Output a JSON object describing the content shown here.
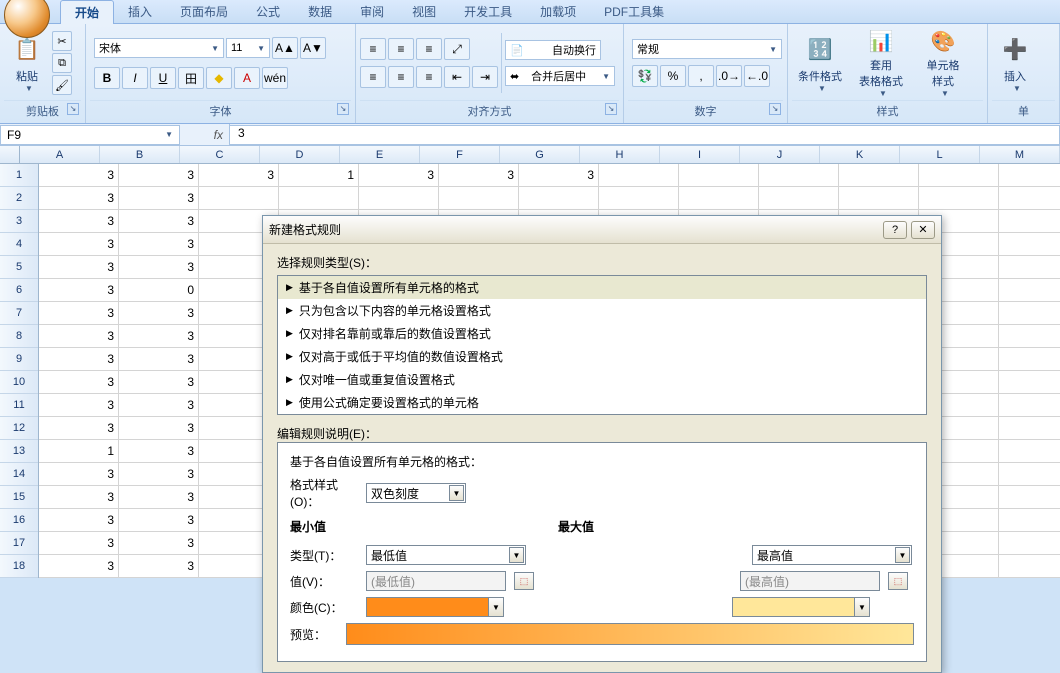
{
  "tabs": {
    "home": "开始",
    "insert": "插入",
    "layout": "页面布局",
    "formula": "公式",
    "data": "数据",
    "review": "审阅",
    "view": "视图",
    "dev": "开发工具",
    "addin": "加载项",
    "pdf": "PDF工具集"
  },
  "ribbon": {
    "clipboard": {
      "title": "剪贴板",
      "paste": "粘贴"
    },
    "font": {
      "title": "字体",
      "name": "宋体",
      "size": "11"
    },
    "align": {
      "title": "对齐方式",
      "wrap": "自动换行",
      "merge": "合并后居中"
    },
    "number": {
      "title": "数字",
      "general": "常规"
    },
    "styles": {
      "title": "样式",
      "cond": "条件格式",
      "table": "套用\n表格格式",
      "cell": "单元格\n样式"
    },
    "cells": {
      "title": "单",
      "insert": "插入"
    }
  },
  "namebox": "F9",
  "fx_value": "3",
  "columns": [
    "A",
    "B",
    "C",
    "D",
    "E",
    "F",
    "G",
    "H",
    "I",
    "J",
    "K",
    "L",
    "M"
  ],
  "rows": [
    1,
    2,
    3,
    4,
    5,
    6,
    7,
    8,
    9,
    10,
    11,
    12,
    13,
    14,
    15,
    16,
    17,
    18
  ],
  "cells": {
    "r1": [
      "3",
      "3",
      "3",
      "1",
      "3",
      "3",
      "3"
    ],
    "other": [
      "3",
      "3"
    ],
    "r6": [
      "3",
      "0"
    ],
    "r13": [
      "1",
      "3"
    ]
  },
  "dialog": {
    "title": "新建格式规则",
    "select_type": "选择规则类型(S)：",
    "types": [
      "基于各自值设置所有单元格的格式",
      "只为包含以下内容的单元格设置格式",
      "仅对排名靠前或靠后的数值设置格式",
      "仅对高于或低于平均值的数值设置格式",
      "仅对唯一值或重复值设置格式",
      "使用公式确定要设置格式的单元格"
    ],
    "edit_desc": "编辑规则说明(E)：",
    "edit_heading": "基于各自值设置所有单元格的格式：",
    "style_label": "格式样式(O)：",
    "style_value": "双色刻度",
    "min_head": "最小值",
    "max_head": "最大值",
    "type_label": "类型(T)：",
    "type_min": "最低值",
    "type_max": "最高值",
    "value_label": "值(V)：",
    "value_min_hint": "(最低值)",
    "value_max_hint": "(最高值)",
    "color_label": "颜色(C)：",
    "min_color": "#ff8c1a",
    "max_color": "#ffe79a",
    "preview_label": "预览："
  }
}
